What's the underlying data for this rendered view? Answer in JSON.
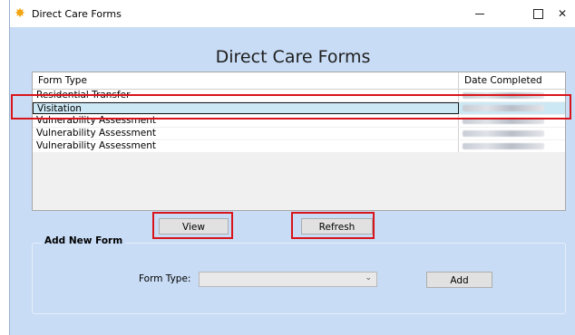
{
  "window": {
    "title": "Direct Care Forms",
    "icon": "star-burst-icon",
    "controls": {
      "minimize": "—",
      "maximize": "☐",
      "close": "✕"
    }
  },
  "page": {
    "title": "Direct Care Forms"
  },
  "grid": {
    "columns": [
      "Form Type",
      "Date Completed"
    ],
    "rows": [
      {
        "form_type": "Residential Transfer",
        "date": "",
        "selected": false
      },
      {
        "form_type": "Visitation",
        "date": "",
        "selected": true
      },
      {
        "form_type": "Vulnerability Assessment",
        "date": "",
        "selected": false
      },
      {
        "form_type": "Vulnerability Assessment",
        "date": "",
        "selected": false
      },
      {
        "form_type": "Vulnerability Assessment",
        "date": "",
        "selected": false
      }
    ]
  },
  "buttons": {
    "view": "View",
    "refresh": "Refresh"
  },
  "add_new_form": {
    "group_title": "Add New Form",
    "form_type_label": "Form Type:",
    "form_type_value": "",
    "add_button": "Add"
  },
  "colors": {
    "highlight": "#d9141a",
    "selected_row": "#cce8f4",
    "window_bg": "#c8dcf5"
  }
}
